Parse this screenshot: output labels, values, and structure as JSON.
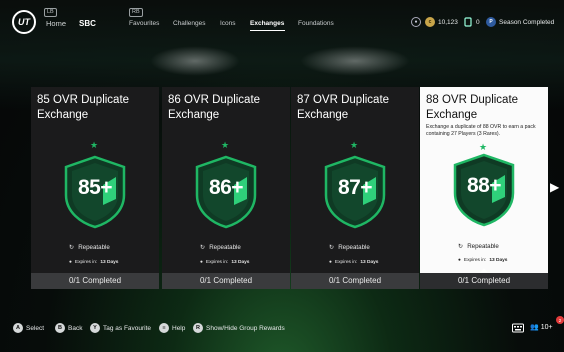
{
  "topbar": {
    "logo": "UT",
    "lb_hint": "LB",
    "rb_hint": "RB",
    "nav": [
      "Home",
      "SBC"
    ],
    "subnav": [
      "Favourites",
      "Challenges",
      "Icons",
      "Exchanges",
      "Foundations"
    ],
    "active_subnav": "Exchanges",
    "coins": "10,123",
    "points": "0",
    "season": "Season Completed"
  },
  "cards": [
    {
      "title": "85 OVR Duplicate Exchange",
      "badge": "85+",
      "repeat": "Repeatable",
      "expires_label": "Expires in:",
      "expires_value": "13 Days",
      "status": "0/1 Completed",
      "description": ""
    },
    {
      "title": "86 OVR Duplicate Exchange",
      "badge": "86+",
      "repeat": "Repeatable",
      "expires_label": "Expires in:",
      "expires_value": "13 Days",
      "status": "0/1 Completed",
      "description": ""
    },
    {
      "title": "87 OVR Duplicate Exchange",
      "badge": "87+",
      "repeat": "Repeatable",
      "expires_label": "Expires in:",
      "expires_value": "13 Days",
      "status": "0/1 Completed",
      "description": ""
    },
    {
      "title": "88 OVR Duplicate Exchange",
      "badge": "88+",
      "repeat": "Repeatable",
      "expires_label": "Expires in:",
      "expires_value": "13 Days",
      "status": "0/1 Completed",
      "description": "Exchange a duplicate of 88 OVR to earn a pack containing 27 Players (3 Rares)."
    }
  ],
  "bottombar": {
    "hints": [
      {
        "button": "A",
        "label": "Select"
      },
      {
        "button": "B",
        "label": "Back"
      },
      {
        "button": "Y",
        "label": "Tag as Favourite"
      },
      {
        "button": "≡",
        "label": "Help"
      },
      {
        "button": "R",
        "label": "Show/Hide Group Rewards"
      }
    ],
    "friends_count": "10+",
    "notification_count": "2"
  },
  "colors": {
    "accent_green": "#1fb764",
    "selected_card": "#fbfbfb",
    "card_bg": "#1b1b1c"
  }
}
